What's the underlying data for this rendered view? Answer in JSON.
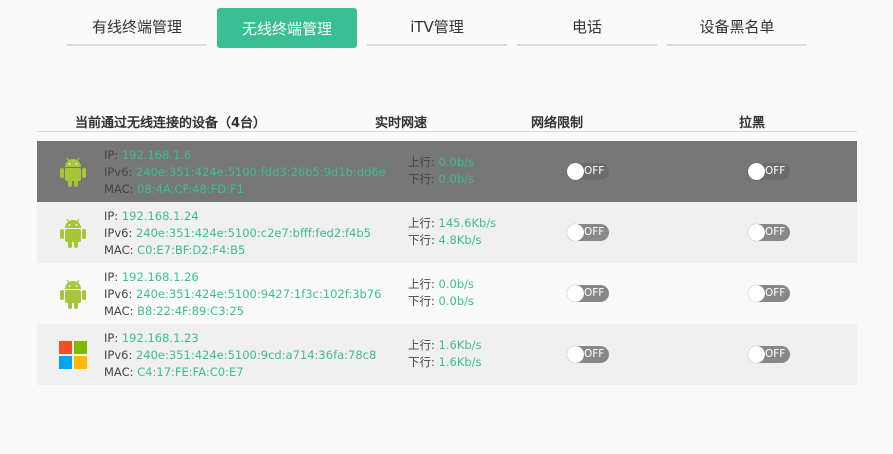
{
  "tabs": [
    {
      "label": "有线终端管理",
      "active": false
    },
    {
      "label": "无线终端管理",
      "active": true
    },
    {
      "label": "iTV管理",
      "active": false
    },
    {
      "label": "电话",
      "active": false
    },
    {
      "label": "设备黑名单",
      "active": false
    }
  ],
  "table": {
    "headers": {
      "device": "当前通过无线连接的设备（4台）",
      "speed": "实时网速",
      "limit": "网络限制",
      "blacklist": "拉黑"
    },
    "labels": {
      "ip": "IP: ",
      "ipv6": "IPv6: ",
      "mac": "MAC: ",
      "up": "上行: ",
      "down": "下行: "
    },
    "rows": [
      {
        "icon": "android-icon",
        "ip": "192.168.1.6",
        "ipv6": "240e:351:424e:5100:fdd3:26b5:9d1b:dd6e",
        "mac": "08:4A:CF:48:FD:F1",
        "up": "0.0b/s",
        "down": "0.0b/s",
        "limit": "OFF",
        "blacklist": "OFF"
      },
      {
        "icon": "android-icon",
        "ip": "192.168.1.24",
        "ipv6": "240e:351:424e:5100:c2e7:bfff:fed2:f4b5",
        "mac": "C0:E7:BF:D2:F4:B5",
        "up": "145.6Kb/s",
        "down": "4.8Kb/s",
        "limit": "OFF",
        "blacklist": "OFF"
      },
      {
        "icon": "android-icon",
        "ip": "192.168.1.26",
        "ipv6": "240e:351:424e:5100:9427:1f3c:102f:3b76",
        "mac": "B8:22:4F:89:C3:25",
        "up": "0.0b/s",
        "down": "0.0b/s",
        "limit": "OFF",
        "blacklist": "OFF"
      },
      {
        "icon": "windows-icon",
        "ip": "192.168.1.23",
        "ipv6": "240e:351:424e:5100:9cd:a714:36fa:78c8",
        "mac": "C4:17:FE:FA:C0:E7",
        "up": "1.6Kb/s",
        "down": "1.6Kb/s",
        "limit": "OFF",
        "blacklist": "OFF"
      }
    ]
  },
  "colors": {
    "accent": "#3cbe94",
    "android": "#a4c639",
    "highlight_row": "#777777"
  }
}
